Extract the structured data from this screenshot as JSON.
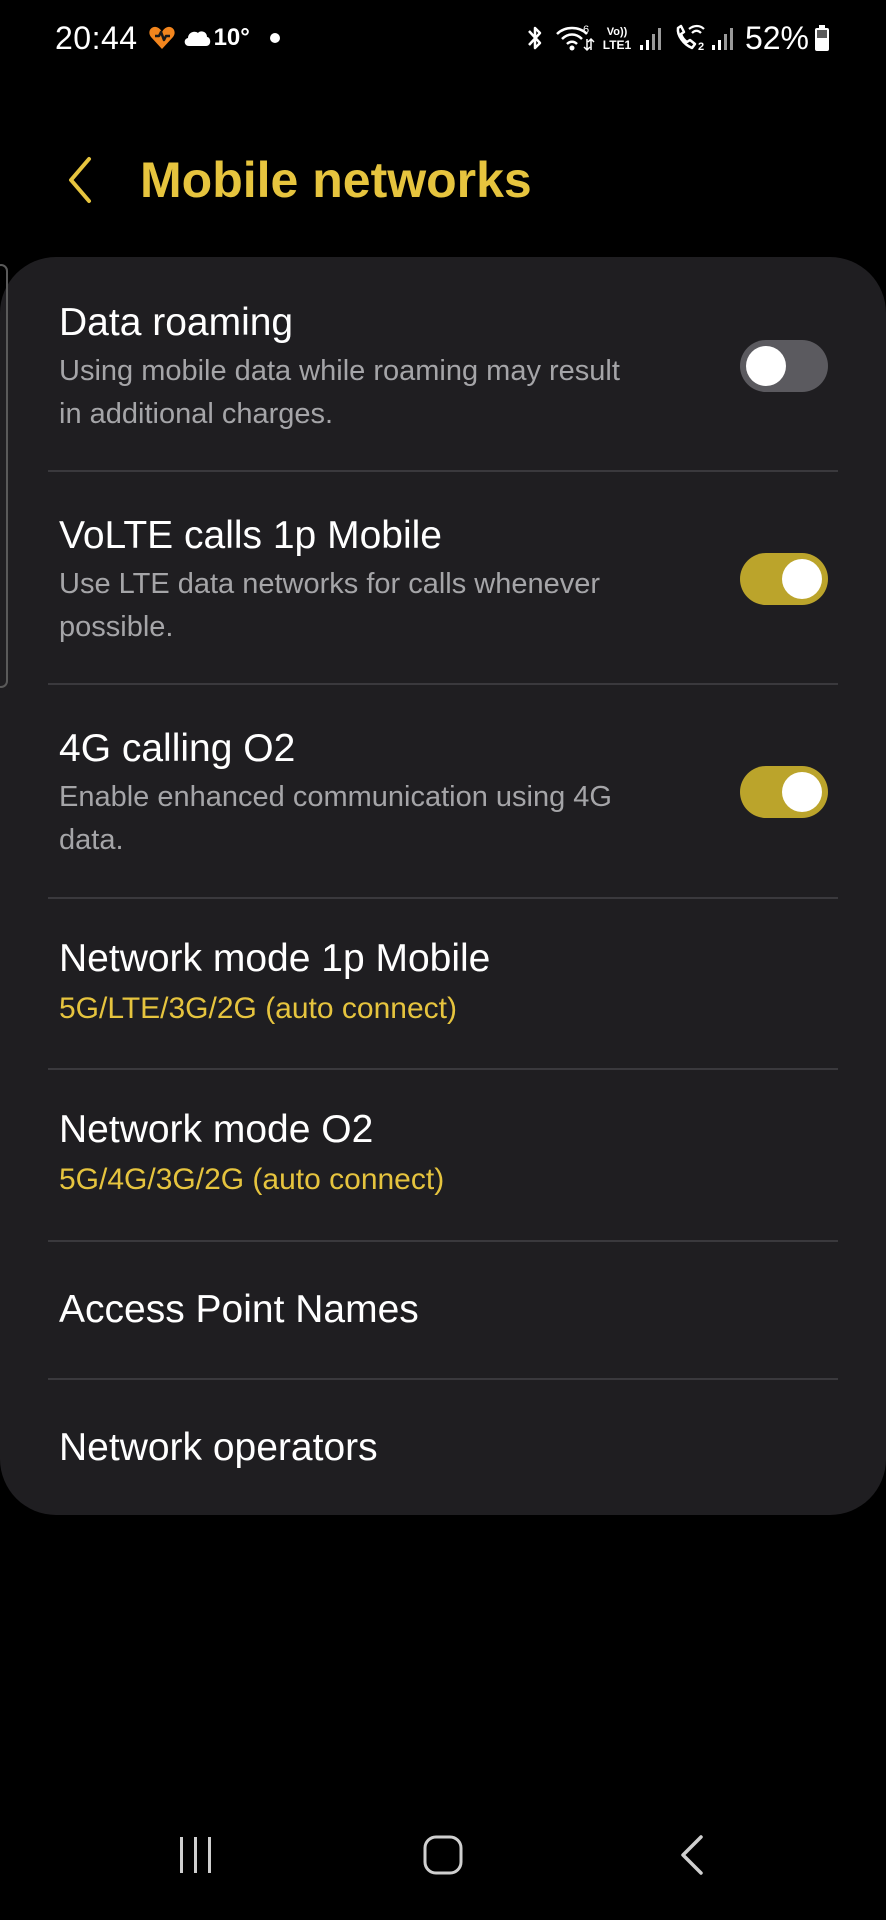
{
  "status_bar": {
    "time": "20:44",
    "temperature": "10°",
    "battery": "52%",
    "icons": [
      "heart-app-icon",
      "cloud-icon",
      "notification-dot",
      "bluetooth-icon",
      "wifi-6-icon",
      "volte-lte1-icon",
      "signal-sim1-icon",
      "wifi-calling-sim2-icon",
      "signal-sim2-icon",
      "battery-icon"
    ],
    "volte_label_top": "Vo))",
    "volte_label_bottom": "LTE1",
    "wifi_label": "6"
  },
  "header": {
    "title": "Mobile networks",
    "back_icon": "chevron-left-icon"
  },
  "settings": [
    {
      "title": "Data roaming",
      "description_line1": "Using mobile data while roaming may result",
      "description_line2": "in additional charges.",
      "toggle": false
    },
    {
      "title": "VoLTE calls 1p Mobile",
      "description_line1": "Use LTE data networks for calls whenever",
      "description_line2": "possible.",
      "toggle": true
    },
    {
      "title": "4G calling O2",
      "description_line1": "Enable enhanced communication using 4G",
      "description_line2": "data.",
      "toggle": true
    },
    {
      "title": "Network mode 1p Mobile",
      "value": "5G/LTE/3G/2G (auto connect)"
    },
    {
      "title": "Network mode O2",
      "value": "5G/4G/3G/2G (auto connect)"
    },
    {
      "title": "Access Point Names"
    },
    {
      "title": "Network operators"
    }
  ],
  "nav_bar": {
    "recents_icon": "recents-icon",
    "home_icon": "home-icon",
    "back_icon": "back-icon"
  },
  "colors": {
    "accent": "#e6c43e",
    "toggle_on": "#bba42b",
    "toggle_off": "#5b5a5f",
    "card_background": "#1f1e21",
    "background": "#000000"
  }
}
